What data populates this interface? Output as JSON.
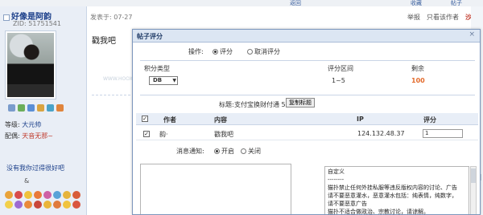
{
  "topbar": {
    "link_left": "返回",
    "link_right": "收藏",
    "menu_right": "帖子"
  },
  "user": {
    "name": "好像是阿韵",
    "zid": "ZID: 51751541",
    "level_label": "等级:",
    "level_value": "大元帅",
    "medal_label": "配偶:",
    "medal_value": "天音无那~",
    "signature": "没有我你过得很好吧",
    "amp": "&"
  },
  "post": {
    "meta": "发表于: 07-27",
    "body": "戳我吧",
    "tools": [
      "举报",
      "只看该作者"
    ],
    "floor": "沙发",
    "watermark": "WWW.HOOXOO.COM"
  },
  "dialog": {
    "title": "帖子评分",
    "close": "×",
    "op_label": "操作:",
    "op_options": [
      "评分",
      "取消评分"
    ],
    "type_header": "积分类型",
    "range_header": "评分区间",
    "left_header": "剩余",
    "type_value": "DB",
    "range_value": "1~5",
    "left_value": "100",
    "reason_label": "标题:",
    "reason_text": "支付宝换财付通 5元换5元",
    "reason_button": "复制标题",
    "table_headers": {
      "author": "作者",
      "content": "内容",
      "ip": "IP",
      "score": "评分"
    },
    "row": {
      "author": "韵·",
      "content": "戳我吧",
      "ip": "124.132.48.37",
      "score": "1"
    },
    "notify_label": "消息通知:",
    "notify_options": [
      "开启",
      "关闭"
    ],
    "custom_reasons": [
      "自定义",
      "--------",
      "猫扑禁止任何外挂私服等违反版权内容的讨论、广告",
      "请不要恶意灌水，恶意灌水包括：纯表情，纯数字，",
      "请不要恶意广告",
      "猫扑不适合做政治、宗教讨论，请谅解。"
    ]
  },
  "colors": {
    "accent": "#1b3f8a",
    "remaining": "#e36b2c",
    "title_bar": "#dce6f3"
  },
  "icons": [
    "user-icon",
    "close-icon",
    "select-arrow-icon",
    "checkbox-icon",
    "radio-icon"
  ]
}
